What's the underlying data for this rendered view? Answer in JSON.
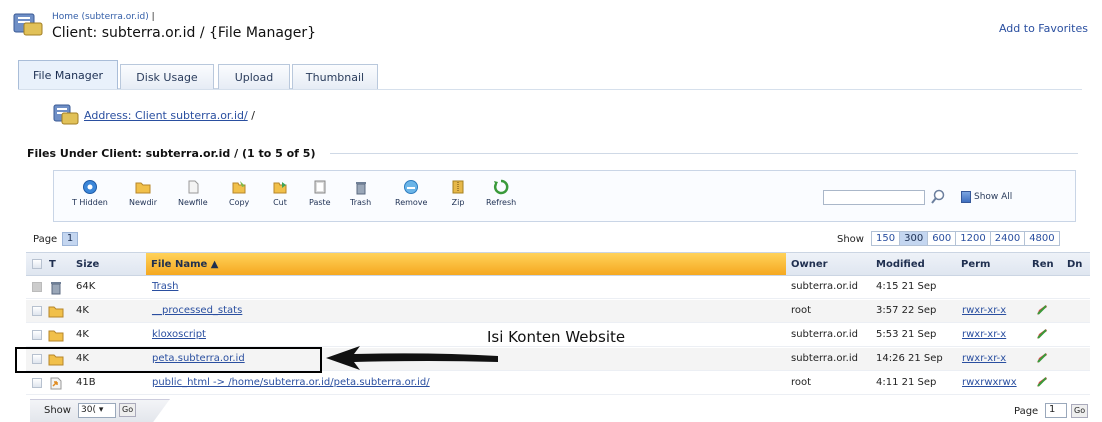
{
  "header": {
    "home_link": "Home (subterra.or.id)",
    "separator": "|",
    "title": "Client: subterra.or.id / {File Manager}",
    "add_favorites": "Add to Favorites"
  },
  "tabs": [
    {
      "label": "File Manager",
      "active": true
    },
    {
      "label": "Disk Usage",
      "active": false
    },
    {
      "label": "Upload",
      "active": false
    },
    {
      "label": "Thumbnail",
      "active": false
    }
  ],
  "address": {
    "link": "Address: Client subterra.or.id/",
    "suffix": " /"
  },
  "section": {
    "heading": "Files Under Client: subterra.or.id / (1 to 5 of 5)"
  },
  "toolbar": {
    "tools": [
      {
        "label": "T Hidden",
        "icon": "eye-icon"
      },
      {
        "label": "Newdir",
        "icon": "new-folder-icon"
      },
      {
        "label": "Newfile",
        "icon": "new-file-icon"
      },
      {
        "label": "Copy",
        "icon": "copy-icon"
      },
      {
        "label": "Cut",
        "icon": "cut-icon"
      },
      {
        "label": "Paste",
        "icon": "paste-icon"
      },
      {
        "label": "Trash",
        "icon": "trash-icon"
      },
      {
        "label": "Remove",
        "icon": "remove-icon"
      },
      {
        "label": "Zip",
        "icon": "zip-icon"
      },
      {
        "label": "Refresh",
        "icon": "refresh-icon"
      }
    ],
    "search_value": "",
    "show_all": "Show All"
  },
  "paging": {
    "page_label": "Page",
    "page_current": "1",
    "show_label": "Show",
    "show_options": [
      "150",
      "300",
      "600",
      "1200",
      "2400",
      "4800"
    ],
    "show_selected": "300"
  },
  "table": {
    "headers": {
      "t": "T",
      "size": "Size",
      "file_name": "File Name ▲",
      "owner": "Owner",
      "modified": "Modified",
      "perm": "Perm",
      "ren": "Ren",
      "dn": "Dn"
    },
    "rows": [
      {
        "type": "trash",
        "size": "64K",
        "name": "Trash",
        "owner": "subterra.or.id",
        "modified": "4:15 21 Sep",
        "perm": ""
      },
      {
        "type": "folder",
        "size": "4K",
        "name": "__processed_stats",
        "owner": "root",
        "modified": "3:57 22 Sep",
        "perm": "rwxr-xr-x"
      },
      {
        "type": "folder",
        "size": "4K",
        "name": "kloxoscript",
        "owner": "subterra.or.id",
        "modified": "5:53 21 Sep",
        "perm": "rwxr-xr-x"
      },
      {
        "type": "folder",
        "size": "4K",
        "name": "peta.subterra.or.id",
        "owner": "subterra.or.id",
        "modified": "14:26 21 Sep",
        "perm": "rwxr-xr-x"
      },
      {
        "type": "link",
        "size": "41B",
        "name": "public_html -> /home/subterra.or.id/peta.subterra.or.id/",
        "owner": "root",
        "modified": "4:11 21 Sep",
        "perm": "rwxrwxrwx"
      }
    ]
  },
  "annotation": {
    "text": "Isi Konten Website"
  },
  "footer": {
    "show_label": "Show",
    "show_value": "30( ▾",
    "go": "Go",
    "page_label": "Page",
    "page_value": "1",
    "go2": "Go"
  },
  "colors": {
    "accent": "#2a4fa0",
    "header_orange": "#f5a820",
    "tab_bg": "#e9f1fb"
  }
}
